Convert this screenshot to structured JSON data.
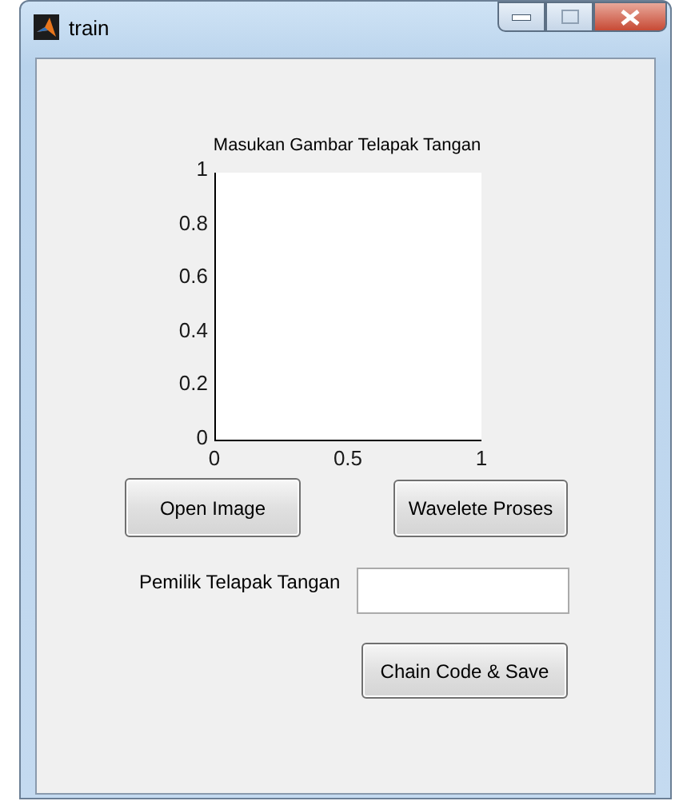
{
  "window": {
    "title": "train"
  },
  "axes": {
    "title": "Masukan Gambar Telapak Tangan",
    "yticks": [
      "1",
      "0.8",
      "0.6",
      "0.4",
      "0.2",
      "0"
    ],
    "xticks": [
      "0",
      "0.5",
      "1"
    ]
  },
  "buttons": [
    {
      "kind": "open",
      "label": "Open Image"
    },
    {
      "kind": "wavelet",
      "label": "Wavelete Proses"
    },
    {
      "kind": "save",
      "label": "Chain Code & Save"
    }
  ],
  "owner": {
    "label": "Pemilik Telapak Tangan"
  }
}
